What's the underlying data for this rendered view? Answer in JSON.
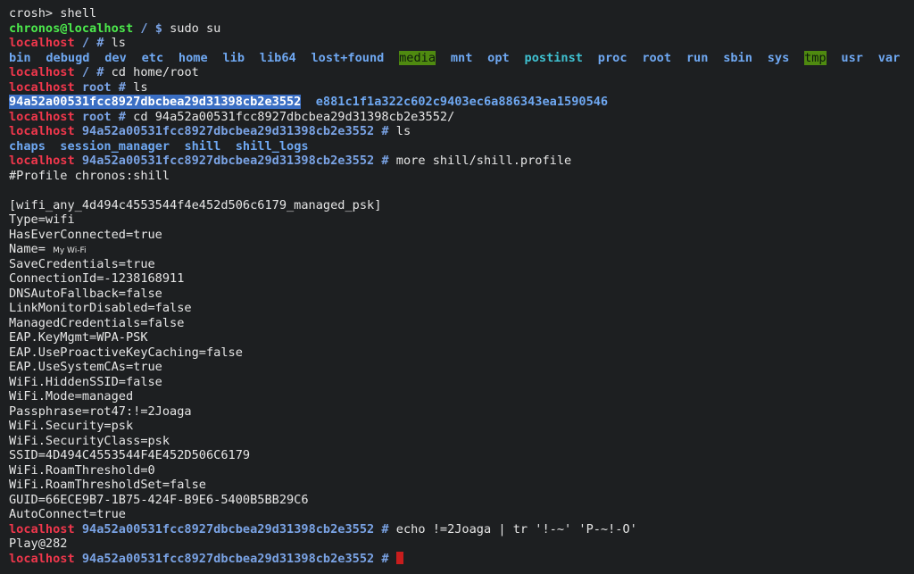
{
  "terminal": {
    "line1": {
      "prompt": "crosh>",
      "cmd": " shell"
    },
    "line2": {
      "user": "chronos@localhost",
      "path": " / $",
      "cmd": " sudo su"
    },
    "line3": {
      "host": "localhost",
      "path": " / #",
      "cmd": " ls"
    },
    "ls_root": [
      "bin",
      "debugd",
      "dev",
      "etc",
      "home",
      "lib",
      "lib64",
      "lost+found",
      "media",
      "mnt",
      "opt",
      "postinst",
      "proc",
      "root",
      "run",
      "sbin",
      "sys",
      "tmp",
      "usr",
      "var"
    ],
    "line5": {
      "host": "localhost",
      "path": " / #",
      "cmd": " cd home/root"
    },
    "line6": {
      "host": "localhost",
      "path": " root #",
      "cmd": " ls"
    },
    "line7": {
      "selected": "94a52a00531fcc8927dbcbea29d31398cb2e3552",
      "other": "e881c1f1a322c602c9403ec6a886343ea1590546"
    },
    "line8": {
      "host": "localhost",
      "path": " root #",
      "cmd": " cd 94a52a00531fcc8927dbcbea29d31398cb2e3552/"
    },
    "line9": {
      "host": "localhost",
      "path": " 94a52a00531fcc8927dbcbea29d31398cb2e3552 #",
      "cmd": " ls"
    },
    "ls_user": [
      "chaps",
      "session_manager",
      "shill",
      "shill_logs"
    ],
    "line11": {
      "host": "localhost",
      "path": " 94a52a00531fcc8927dbcbea29d31398cb2e3552 #",
      "cmd": " more shill/shill.profile"
    },
    "line12": "#Profile chronos:shill",
    "line13": "",
    "line14": "[wifi_any_4d494c4553544f4e452d506c6179_managed_psk]",
    "line15": "Type=wifi",
    "line16": "HasEverConnected=true",
    "line17": {
      "key": "Name= ",
      "value": "My Wi-Fi"
    },
    "line18": "SaveCredentials=true",
    "line19": "ConnectionId=-1238168911",
    "line20": "DNSAutoFallback=false",
    "line21": "LinkMonitorDisabled=false",
    "line22": "ManagedCredentials=false",
    "line23": "EAP.KeyMgmt=WPA-PSK",
    "line24": "EAP.UseProactiveKeyCaching=false",
    "line25": "EAP.UseSystemCAs=true",
    "line26": "WiFi.HiddenSSID=false",
    "line27": "WiFi.Mode=managed",
    "line28": "Passphrase=rot47:!=2Joaga",
    "line29": "WiFi.Security=psk",
    "line30": "WiFi.SecurityClass=psk",
    "line31": "SSID=4D494C4553544F4E452D506C6179",
    "line32": "WiFi.RoamThreshold=0",
    "line33": "WiFi.RoamThresholdSet=false",
    "line34": "GUID=66ECE9B7-1B75-424F-B9E6-5400B5BB29C6",
    "line35": "AutoConnect=true",
    "line36": {
      "host": "localhost",
      "path": " 94a52a00531fcc8927dbcbea29d31398cb2e3552 #",
      "cmd": " echo !=2Joaga | tr '!-~' 'P-~!-O'"
    },
    "line37": "Play@282",
    "line38": {
      "host": "localhost",
      "path": " 94a52a00531fcc8927dbcbea29d31398cb2e3552 #",
      "cmd": " "
    }
  },
  "colors": {
    "background": "#1d1f21",
    "prompt_host": "#f0374c",
    "prompt_user": "#4ce94c",
    "prompt_path": "#7aa3e5",
    "directory": "#6fa8f2",
    "sticky_dir_bg": "#4f8a10",
    "selection": "#3b6fc4",
    "cursor": "#c81d1d"
  }
}
